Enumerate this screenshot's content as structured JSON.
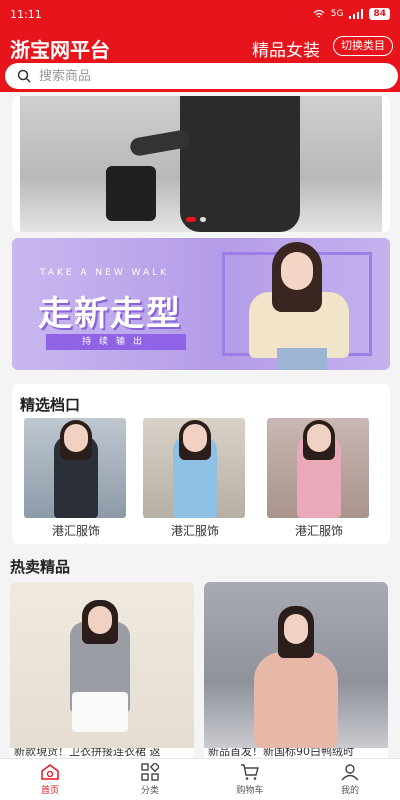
{
  "status_bar": {
    "time": "11:11",
    "network": "5G",
    "battery": "84"
  },
  "header": {
    "app_title": "浙宝网平台",
    "category": "精品女装",
    "switch_button": "切换类目",
    "search_placeholder": "搜索商品"
  },
  "banner_carousel": {
    "slide_count": 2,
    "active_index": 0
  },
  "promo_banner": {
    "tagline": "TAKE A NEW WALK",
    "title": "走新走型",
    "subtitle": "持续输出",
    "accent_color": "#8f62e6"
  },
  "shops_section": {
    "title": "精选档口",
    "items": [
      {
        "name": "港汇服饰"
      },
      {
        "name": "港汇服饰"
      },
      {
        "name": "港汇服饰"
      }
    ]
  },
  "hot_section": {
    "title": "热卖精品",
    "products": [
      {
        "name": "新款現货！卫衣拼接连衣裙 返"
      },
      {
        "name": "新品首发！新国标90白鸭绒时"
      }
    ]
  },
  "tabbar": {
    "items": [
      {
        "label": "首页",
        "icon": "home-icon",
        "active": true
      },
      {
        "label": "分类",
        "icon": "category-icon",
        "active": false
      },
      {
        "label": "购物车",
        "icon": "cart-icon",
        "active": false
      },
      {
        "label": "我的",
        "icon": "user-icon",
        "active": false
      }
    ]
  },
  "colors": {
    "brand": "#e8141b",
    "background": "#f4f4f4"
  }
}
